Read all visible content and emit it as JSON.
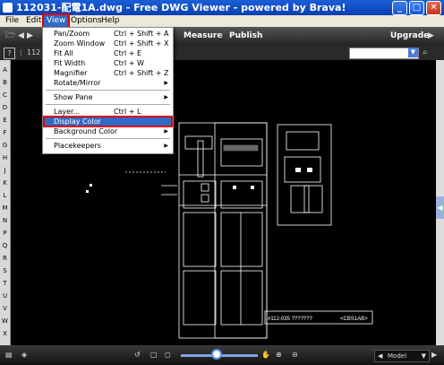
{
  "window": {
    "title": "112031-配電1A.dwg - Free DWG Viewer - powered by Brava!",
    "minimize": "_",
    "maximize": "□",
    "close": "✕"
  },
  "menubar": [
    "File",
    "Edit",
    "View",
    "Options",
    "Help"
  ],
  "view_menu": {
    "items": [
      {
        "label": "Pan/Zoom",
        "shortcut": "Ctrl + Shift + A"
      },
      {
        "label": "Zoom Window",
        "shortcut": "Ctrl + Shift + X"
      },
      {
        "label": "Fit All",
        "shortcut": "Ctrl + E"
      },
      {
        "label": "Fit Width",
        "shortcut": "Ctrl + W"
      },
      {
        "label": "Magnifier",
        "shortcut": "Ctrl + Shift + Z"
      },
      {
        "label": "Rotate/Mirror",
        "shortcut": ""
      },
      {
        "label": "Show Pane",
        "shortcut": ""
      },
      {
        "label": "Layer...",
        "shortcut": "Ctrl + L"
      },
      {
        "label": "Display Color",
        "shortcut": ""
      },
      {
        "label": "Background Color",
        "shortcut": ""
      },
      {
        "label": "Placekeepers",
        "shortcut": ""
      }
    ],
    "highlighted": "Display Color"
  },
  "toolbar": {
    "measure": "Measure",
    "publish": "Publish",
    "upgrade": "Upgrade"
  },
  "toolbar2": {
    "help": "?",
    "tab_text": "112"
  },
  "ruler_letters": [
    "A",
    "B",
    "C",
    "D",
    "E",
    "F",
    "G",
    "H",
    "J",
    "K",
    "L",
    "M",
    "N",
    "P",
    "Q",
    "R",
    "S",
    "T",
    "U",
    "V",
    "W",
    "X"
  ],
  "drawing": {
    "title_block": "#112-035 ???????",
    "title_block_code": "<CBS1AB>"
  },
  "status": {
    "model": "Model"
  },
  "colors": {
    "accent": "#316ac5",
    "highlight_outline": "#e00000",
    "title_bar": "#0a3fb0"
  },
  "icons": [
    "back-icon",
    "forward-icon",
    "folder-icon",
    "layers-icon",
    "rotate-icon",
    "page-icon",
    "fit-icon",
    "zoom-in-icon",
    "zoom-out-icon",
    "pan-icon",
    "search-icon"
  ]
}
